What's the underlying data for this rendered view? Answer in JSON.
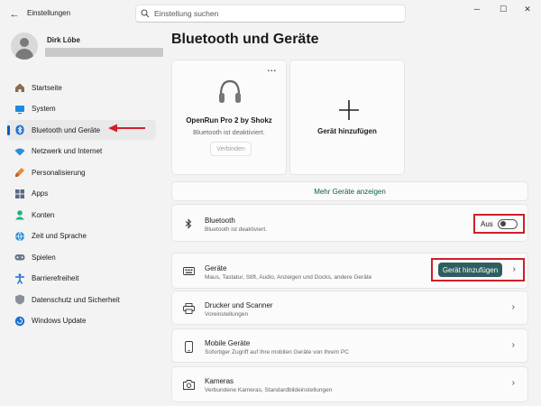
{
  "window": {
    "title": "Einstellungen",
    "controls": [
      "─",
      "☐",
      "✕"
    ]
  },
  "search": {
    "placeholder": "Einstellung suchen"
  },
  "profile": {
    "name": "Dirk Löbe"
  },
  "sidebar": {
    "items": [
      {
        "label": "Startseite",
        "icon": "home-icon"
      },
      {
        "label": "System",
        "icon": "system-icon"
      },
      {
        "label": "Bluetooth und Geräte",
        "icon": "bluetooth-icon",
        "active": true
      },
      {
        "label": "Netzwerk und Internet",
        "icon": "wifi-icon"
      },
      {
        "label": "Personalisierung",
        "icon": "brush-icon"
      },
      {
        "label": "Apps",
        "icon": "apps-icon"
      },
      {
        "label": "Konten",
        "icon": "account-icon"
      },
      {
        "label": "Zeit und Sprache",
        "icon": "globe-icon"
      },
      {
        "label": "Spielen",
        "icon": "gamepad-icon"
      },
      {
        "label": "Barrierefreiheit",
        "icon": "accessibility-icon"
      },
      {
        "label": "Datenschutz und Sicherheit",
        "icon": "shield-icon"
      },
      {
        "label": "Windows Update",
        "icon": "update-icon"
      }
    ]
  },
  "main": {
    "title": "Bluetooth und Geräte",
    "device_card": {
      "name": "OpenRun Pro 2 by Shokz",
      "status": "Bluetooth ist deaktiviert.",
      "connect_label": "Verbinden",
      "more_label": "..."
    },
    "add_card": {
      "label": "Gerät hinzufügen"
    },
    "more_devices_label": "Mehr Geräte anzeigen",
    "bluetooth_row": {
      "title": "Bluetooth",
      "subtitle": "Bluetooth ist deaktiviert.",
      "toggle_label": "Aus",
      "toggle_on": false
    },
    "devices_row": {
      "title": "Geräte",
      "subtitle": "Maus, Tastatur, Stift, Audio, Anzeigen und Docks, andere Geräte",
      "button_label": "Gerät hinzufügen"
    },
    "printers_row": {
      "title": "Drucker und Scanner",
      "subtitle": "Voreinstellungen"
    },
    "mobile_row": {
      "title": "Mobile Geräte",
      "subtitle": "Sofortiger Zugriff auf Ihre mobilen Geräte von Ihrem PC"
    },
    "cameras_row": {
      "title": "Kameras",
      "subtitle": "Verbundene Kameras, Standardbildeinstellungen"
    }
  },
  "colors": {
    "accent": "#005fb8",
    "highlight": "#d01f2a",
    "primary_button": "#2e5e5e"
  }
}
